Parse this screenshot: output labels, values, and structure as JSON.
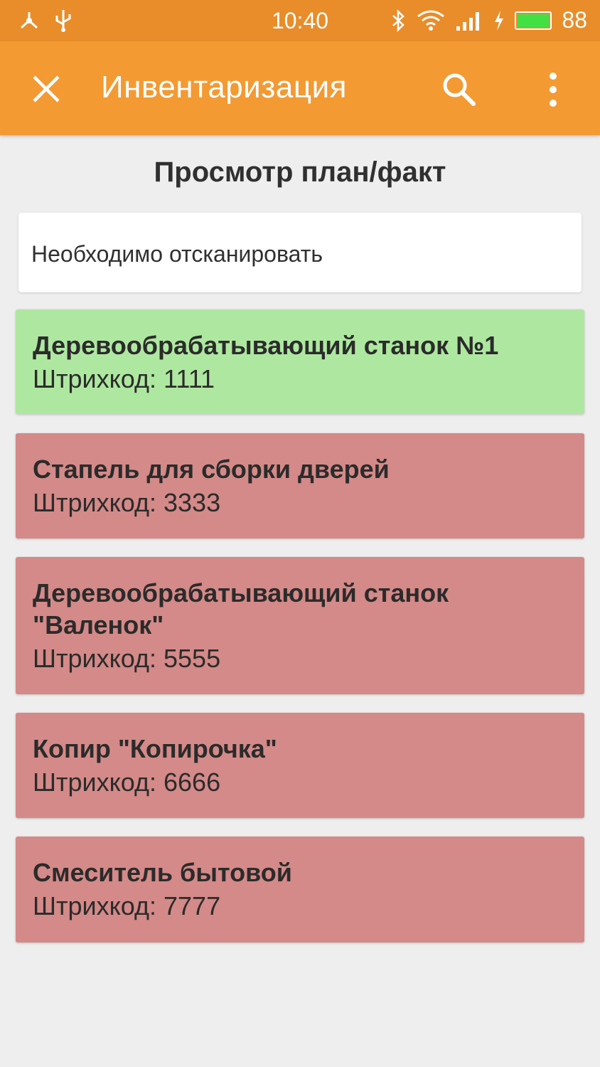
{
  "status_bar": {
    "time": "10:40",
    "battery_level": "88",
    "icons": [
      "usb-debug-icon",
      "usb-icon",
      "bluetooth-icon",
      "wifi-icon",
      "signal-icon",
      "charging-icon",
      "battery-icon"
    ]
  },
  "app_bar": {
    "title": "Инвентаризация",
    "close_icon": "close-icon",
    "search_icon": "search-icon",
    "menu_icon": "more-vert-icon"
  },
  "page": {
    "title": "Просмотр план/факт",
    "section_label": "Необходимо отсканировать"
  },
  "colors": {
    "status_bar": "#e88d2a",
    "app_bar": "#f39a33",
    "scanned": "#aee8a0",
    "not_scanned": "#d48a88"
  },
  "items": [
    {
      "name": "Деревообрабатывающий станок №1",
      "barcode": "Штрихкод: 1111",
      "status": "scanned"
    },
    {
      "name": "Стапель для сборки дверей",
      "barcode": "Штрихкод: 3333",
      "status": "not_scanned"
    },
    {
      "name": "Деревообрабатывающий станок \"Валенок\"",
      "barcode": "Штрихкод: 5555",
      "status": "not_scanned"
    },
    {
      "name": "Копир \"Копирочка\"",
      "barcode": "Штрихкод: 6666",
      "status": "not_scanned"
    },
    {
      "name": "Смеситель бытовой",
      "barcode": "Штрихкод: 7777",
      "status": "not_scanned"
    }
  ]
}
